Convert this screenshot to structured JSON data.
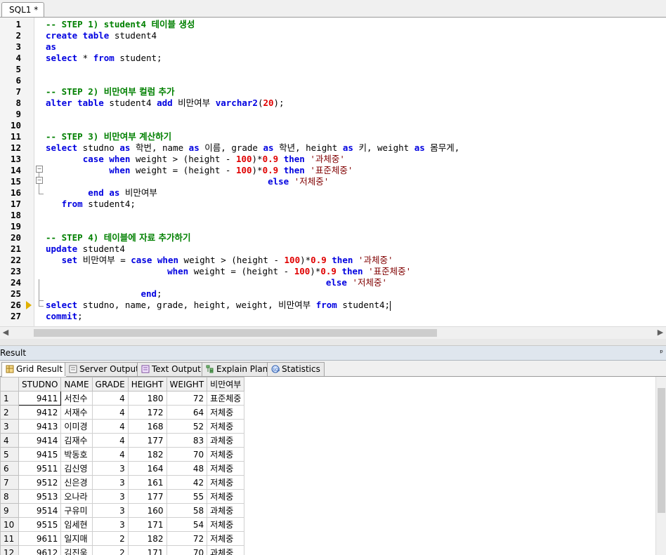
{
  "doc_tab": "SQL1 *",
  "editor": {
    "lines": [
      {
        "n": "1",
        "html": "<span class=\"cm\">-- STEP 1) student4 <span class=\"kr\">테이블 생성</span></span>"
      },
      {
        "n": "2",
        "html": "<span class=\"kw\">create table</span> student4"
      },
      {
        "n": "3",
        "html": "<span class=\"kw\">as</span>"
      },
      {
        "n": "4",
        "html": "<span class=\"kw\">select</span> * <span class=\"kw\">from</span> student;"
      },
      {
        "n": "5",
        "html": ""
      },
      {
        "n": "6",
        "html": ""
      },
      {
        "n": "7",
        "html": "<span class=\"cm\">-- STEP 2) <span class=\"kr\">비만여부 컬럼 추가</span></span>"
      },
      {
        "n": "8",
        "html": "<span class=\"kw\">alter table</span> student4 <span class=\"kw\">add</span> <span class=\"kr\">비만여부</span> <span class=\"kw\">varchar2</span>(<span class=\"num\">20</span>);"
      },
      {
        "n": "9",
        "html": ""
      },
      {
        "n": "10",
        "html": ""
      },
      {
        "n": "11",
        "html": "<span class=\"cm\">-- STEP 3) <span class=\"kr\">비만여부 계산하기</span></span>"
      },
      {
        "n": "12",
        "html": "<span class=\"kw\">select</span> studno <span class=\"kw\">as</span> <span class=\"kr\">학번</span>, name <span class=\"kw\">as</span> <span class=\"kr\">이름</span>, grade <span class=\"kw\">as</span> <span class=\"kr\">학년</span>, height <span class=\"kw\">as</span> <span class=\"kr\">키</span>, weight <span class=\"kw\">as</span> <span class=\"kr\">몸무게</span>,"
      },
      {
        "n": "13",
        "html": "       <span class=\"kw\">case when</span> weight &gt; (height - <span class=\"num\">100</span>)*<span class=\"num\">0.9</span> <span class=\"kw\">then</span> <span class=\"str\">'<span class=\"kr\">과체중</span>'</span>"
      },
      {
        "n": "14",
        "html": "            <span class=\"kw\">when</span> weight = (height - <span class=\"num\">100</span>)*<span class=\"num\">0.9</span> <span class=\"kw\">then</span> <span class=\"str\">'<span class=\"kr\">표준체중</span>'</span>"
      },
      {
        "n": "15",
        "html": "                                          <span class=\"kw\">else</span> <span class=\"str\">'<span class=\"kr\">저체중</span>'</span>"
      },
      {
        "n": "16",
        "html": "        <span class=\"kw\">end as</span> <span class=\"kr\">비만여부</span>"
      },
      {
        "n": "17",
        "html": "   <span class=\"kw\">from</span> student4;"
      },
      {
        "n": "18",
        "html": ""
      },
      {
        "n": "19",
        "html": ""
      },
      {
        "n": "20",
        "html": "<span class=\"cm\">-- STEP 4) <span class=\"kr\">테이블에 자료 추가하기</span></span>"
      },
      {
        "n": "21",
        "html": "<span class=\"kw\">update</span> student4"
      },
      {
        "n": "22",
        "html": "   <span class=\"kw\">set</span> <span class=\"kr\">비만여부</span> = <span class=\"kw\">case when</span> weight &gt; (height - <span class=\"num\">100</span>)*<span class=\"num\">0.9</span> <span class=\"kw\">then</span> <span class=\"str\">'<span class=\"kr\">과체중</span>'</span>"
      },
      {
        "n": "23",
        "html": "                       <span class=\"kw\">when</span> weight = (height - <span class=\"num\">100</span>)*<span class=\"num\">0.9</span> <span class=\"kw\">then</span> <span class=\"str\">'<span class=\"kr\">표준체중</span>'</span>"
      },
      {
        "n": "24",
        "html": "                                                     <span class=\"kw\">else</span> <span class=\"str\">'<span class=\"kr\">저체중</span>'</span>"
      },
      {
        "n": "25",
        "html": "                  <span class=\"kw\">end</span>;"
      },
      {
        "n": "26",
        "html": "<span class=\"kw\">select</span> studno, name, grade, height, weight, <span class=\"kr\">비만여부</span> <span class=\"kw\">from</span> student4;<span class=\"caret\"></span>"
      },
      {
        "n": "27",
        "html": "<span class=\"kw\">commit</span>;"
      }
    ]
  },
  "result": {
    "title": "Result",
    "pin": "ᵖ",
    "tabs": [
      "Grid Result",
      "Server Output",
      "Text Output",
      "Explain Plan",
      "Statistics"
    ],
    "columns": [
      "STUDNO",
      "NAME",
      "GRADE",
      "HEIGHT",
      "WEIGHT",
      "비만여부"
    ],
    "rows": [
      [
        "1",
        "9411",
        "서진수",
        "4",
        "180",
        "72",
        "표준체중"
      ],
      [
        "2",
        "9412",
        "서재수",
        "4",
        "172",
        "64",
        "저체중"
      ],
      [
        "3",
        "9413",
        "이미경",
        "4",
        "168",
        "52",
        "저체중"
      ],
      [
        "4",
        "9414",
        "김재수",
        "4",
        "177",
        "83",
        "과체중"
      ],
      [
        "5",
        "9415",
        "박동호",
        "4",
        "182",
        "70",
        "저체중"
      ],
      [
        "6",
        "9511",
        "김신영",
        "3",
        "164",
        "48",
        "저체중"
      ],
      [
        "7",
        "9512",
        "신은경",
        "3",
        "161",
        "42",
        "저체중"
      ],
      [
        "8",
        "9513",
        "오나라",
        "3",
        "177",
        "55",
        "저체중"
      ],
      [
        "9",
        "9514",
        "구유미",
        "3",
        "160",
        "58",
        "과체중"
      ],
      [
        "10",
        "9515",
        "임세현",
        "3",
        "171",
        "54",
        "저체중"
      ],
      [
        "11",
        "9611",
        "일지매",
        "2",
        "182",
        "72",
        "저체중"
      ],
      [
        "12",
        "9612",
        "김진욱",
        "2",
        "171",
        "70",
        "과체중"
      ]
    ]
  }
}
